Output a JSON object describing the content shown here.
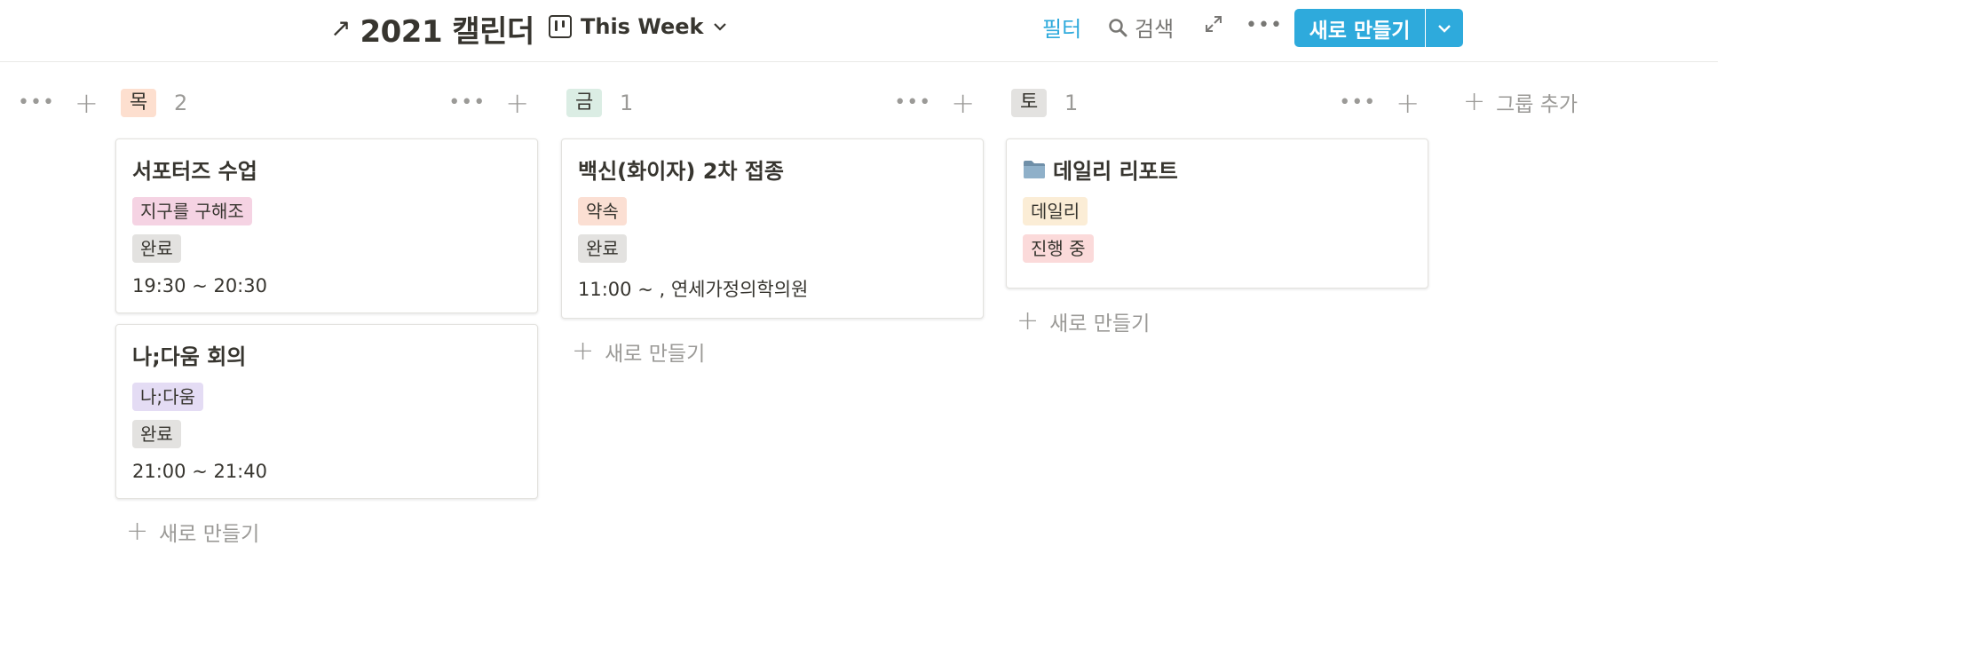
{
  "header": {
    "arrow": "↗",
    "title": "2021 캘린더",
    "view_label": "This Week",
    "filter_label": "필터",
    "search_label": "검색",
    "new_button_label": "새로 만들기",
    "accent_color": "#2eaadc"
  },
  "board": {
    "add_new_label": "새로 만들기",
    "add_group_label": "그룹 추가",
    "columns": [
      {
        "tag": "목",
        "tag_bg": "#fddfcf",
        "count": "2",
        "cards": [
          {
            "title": "서포터즈 수업",
            "tags": [
              {
                "label": "지구를 구해조",
                "bg": "#f5d3e3"
              },
              {
                "label": "완료",
                "bg": "#e3e2e0"
              }
            ],
            "time": "19:30 ~ 20:30"
          },
          {
            "title": "나;다움 회의",
            "tags": [
              {
                "label": "나;다움",
                "bg": "#e4dcf4"
              },
              {
                "label": "완료",
                "bg": "#e3e2e0"
              }
            ],
            "time": "21:00 ~ 21:40"
          }
        ]
      },
      {
        "tag": "금",
        "tag_bg": "#dbede4",
        "count": "1",
        "cards": [
          {
            "title": "백신(화이자) 2차 접종",
            "tags": [
              {
                "label": "약속",
                "bg": "#fbdfd3"
              },
              {
                "label": "완료",
                "bg": "#e3e2e0"
              }
            ],
            "time": "11:00 ~ , 연세가정의학의원"
          }
        ]
      },
      {
        "tag": "토",
        "tag_bg": "#e3e2e0",
        "count": "1",
        "cards": [
          {
            "title": "데일리 리포트",
            "icon": "folder-icon",
            "tags": [
              {
                "label": "데일리",
                "bg": "#fbedd6"
              },
              {
                "label": "진행 중",
                "bg": "#fbdada"
              }
            ],
            "time": ""
          }
        ]
      }
    ]
  }
}
